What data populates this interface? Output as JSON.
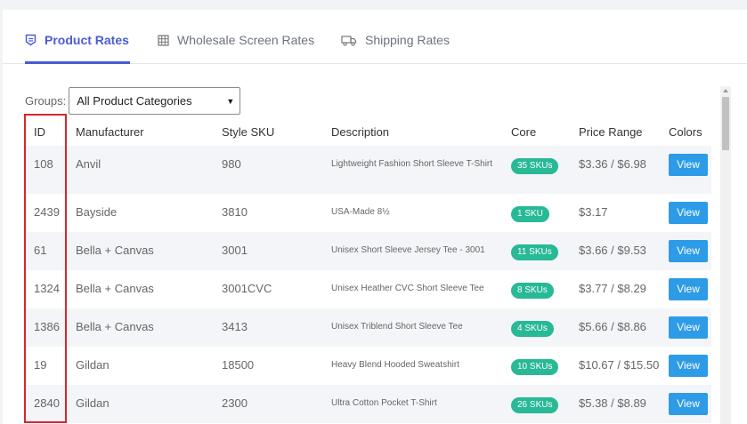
{
  "tabs": [
    {
      "label": "Product Rates",
      "icon": "badge-icon",
      "active": true
    },
    {
      "label": "Wholesale Screen Rates",
      "icon": "grid-icon",
      "active": false
    },
    {
      "label": "Shipping Rates",
      "icon": "truck-icon",
      "active": false
    }
  ],
  "groups": {
    "label": "Groups:",
    "selected": "All Product Categories"
  },
  "table": {
    "headers": [
      "ID",
      "Manufacturer",
      "Style SKU",
      "Description",
      "Core",
      "Price Range",
      "Colors"
    ],
    "rows": [
      {
        "id": "108",
        "manufacturer": "Anvil",
        "sku": "980",
        "description": "Lightweight Fashion Short Sleeve T-Shirt",
        "core": "35 SKUs",
        "price": "$3.36 / $6.98",
        "colors": "View"
      },
      {
        "id": "2439",
        "manufacturer": "Bayside",
        "sku": "3810",
        "description": "USA-Made 8½",
        "core": "1 SKU",
        "price": "$3.17",
        "colors": "View"
      },
      {
        "id": "61",
        "manufacturer": "Bella + Canvas",
        "sku": "3001",
        "description": "Unisex Short Sleeve Jersey Tee - 3001",
        "core": "11 SKUs",
        "price": "$3.66 / $9.53",
        "colors": "View"
      },
      {
        "id": "1324",
        "manufacturer": "Bella + Canvas",
        "sku": "3001CVC",
        "description": "Unisex Heather CVC Short Sleeve Tee",
        "core": "8 SKUs",
        "price": "$3.77 / $8.29",
        "colors": "View"
      },
      {
        "id": "1386",
        "manufacturer": "Bella + Canvas",
        "sku": "3413",
        "description": "Unisex Triblend Short Sleeve Tee",
        "core": "4 SKUs",
        "price": "$5.66 / $8.86",
        "colors": "View"
      },
      {
        "id": "19",
        "manufacturer": "Gildan",
        "sku": "18500",
        "description": "Heavy Blend Hooded Sweatshirt",
        "core": "10 SKUs",
        "price": "$10.67 / $15.50",
        "colors": "View"
      },
      {
        "id": "2840",
        "manufacturer": "Gildan",
        "sku": "2300",
        "description": "Ultra Cotton Pocket T-Shirt",
        "core": "26 SKUs",
        "price": "$5.38 / $8.89",
        "colors": "View"
      }
    ]
  },
  "colors": {
    "accent": "#4b5bd4",
    "badge": "#28b996",
    "button": "#2e9be6",
    "highlight": "#d9262a"
  }
}
